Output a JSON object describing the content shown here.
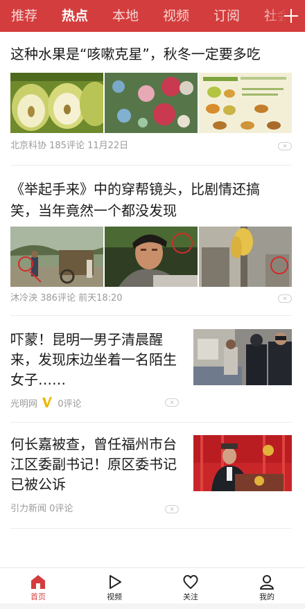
{
  "channels": [
    "推荐",
    "热点",
    "本地",
    "视频",
    "订阅",
    "社会"
  ],
  "active_channel": "热点",
  "articles": [
    {
      "title": "这种水果是“咳嗽克星”，秋冬一定要多吃",
      "meta": "北京科协 185评论 11月22日"
    },
    {
      "title": "《举起手来》中的穿帮镜头，比剧情还搞笑，当年竟然一个都没发现",
      "meta": "沐冷泱 386评论 前天18:20"
    },
    {
      "title": "吓蒙！昆明一男子清晨醒来，发现床边坐着一名陌生女子……",
      "source": "光明网",
      "comments": "0评论"
    },
    {
      "title": "何长嘉被查，曾任福州市台江区委副书记！原区委书记已被公诉",
      "meta": "引力新闻 0评论"
    }
  ],
  "close_glyph": "×",
  "nav": [
    {
      "label": "首页",
      "icon": "home-icon"
    },
    {
      "label": "视频",
      "icon": "play-icon"
    },
    {
      "label": "关注",
      "icon": "heart-icon"
    },
    {
      "label": "我的",
      "icon": "user-icon"
    }
  ],
  "colors": {
    "accent": "#d43d3d",
    "verified": "#f0b400"
  }
}
